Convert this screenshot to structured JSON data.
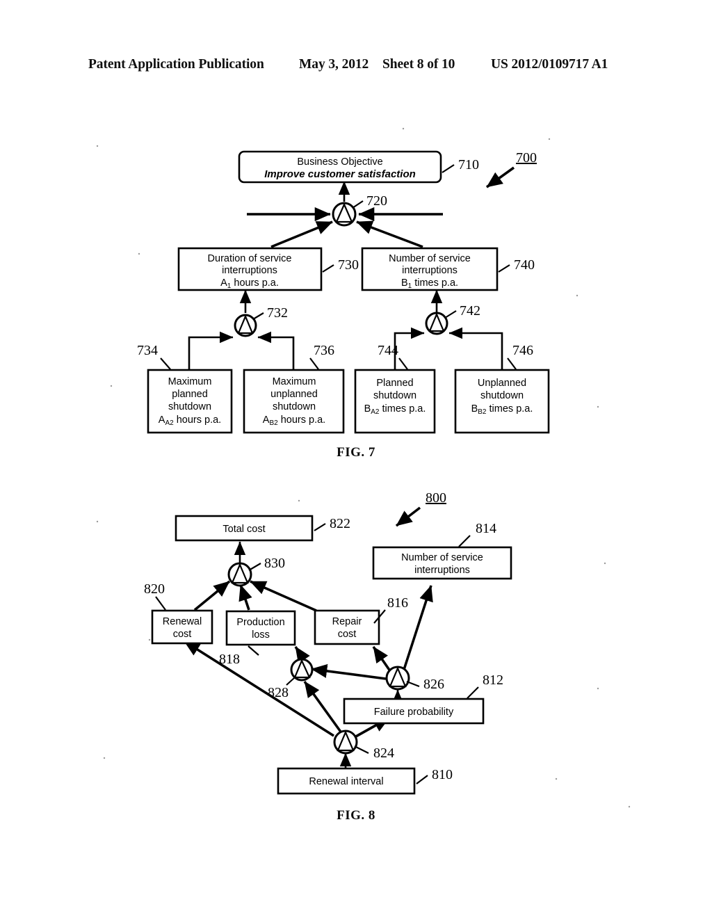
{
  "header": {
    "publication": "Patent Application Publication",
    "date": "May 3, 2012",
    "sheet": "Sheet 8 of 10",
    "patent_number": "US 2012/0109717 A1"
  },
  "figures": [
    {
      "caption": "FIG. 7",
      "figure_ref": "700",
      "nodes": [
        {
          "ref": "710",
          "lines": [
            "Business Objective",
            "Improve customer satisfaction"
          ],
          "emphasis": [
            false,
            true
          ]
        },
        {
          "ref": "720",
          "type": "aggregation-node"
        },
        {
          "ref": "730",
          "lines": [
            "Duration of service",
            "interruptions",
            "A₁ hours p.a."
          ]
        },
        {
          "ref": "740",
          "lines": [
            "Number of service",
            "interruptions",
            "B₁ times p.a."
          ]
        },
        {
          "ref": "732",
          "type": "aggregation-node"
        },
        {
          "ref": "742",
          "type": "aggregation-node"
        },
        {
          "ref": "734",
          "lines": [
            "Maximum",
            "planned",
            "shutdown",
            "Aₐ₂ hours p.a."
          ]
        },
        {
          "ref": "736",
          "lines": [
            "Maximum",
            "unplanned",
            "shutdown",
            "Aʙ₂ hours p.a."
          ]
        },
        {
          "ref": "744",
          "lines": [
            "Planned",
            "shutdown",
            "Bₐ₂ times p.a."
          ]
        },
        {
          "ref": "746",
          "lines": [
            "Unplanned",
            "shutdown",
            "Bʙ₂ times p.a."
          ]
        }
      ]
    },
    {
      "caption": "FIG. 8",
      "figure_ref": "800",
      "nodes": [
        {
          "ref": "822",
          "lines": [
            "Total cost"
          ]
        },
        {
          "ref": "830",
          "type": "aggregation-node"
        },
        {
          "ref": "814",
          "lines": [
            "Number of service",
            "interruptions"
          ]
        },
        {
          "ref": "820",
          "lines": [
            "Renewal",
            "cost"
          ]
        },
        {
          "ref": "818",
          "lines": [
            "Production",
            "loss"
          ]
        },
        {
          "ref": "816",
          "lines": [
            "Repair",
            "cost"
          ]
        },
        {
          "ref": "828",
          "type": "aggregation-node"
        },
        {
          "ref": "826",
          "type": "aggregation-node"
        },
        {
          "ref": "812",
          "lines": [
            "Failure probability"
          ]
        },
        {
          "ref": "824",
          "type": "aggregation-node"
        },
        {
          "ref": "810",
          "lines": [
            "Renewal interval"
          ]
        }
      ]
    }
  ],
  "fig7": {
    "box710_line1": "Business Objective",
    "box710_line2": "Improve customer satisfaction",
    "box730_line1": "Duration of service",
    "box730_line2": "interruptions",
    "box730_line3a": "A",
    "box730_line3sub": "1",
    "box730_line3b": " hours p.a.",
    "box740_line1": "Number of service",
    "box740_line2": "interruptions",
    "box740_line3a": "B",
    "box740_line3sub": "1",
    "box740_line3b": " times p.a.",
    "box734_line1": "Maximum",
    "box734_line2": "planned",
    "box734_line3": "shutdown",
    "box734_line4a": "A",
    "box734_line4sub": "A2",
    "box734_line4b": " hours p.a.",
    "box736_line1": "Maximum",
    "box736_line2": "unplanned",
    "box736_line3": "shutdown",
    "box736_line4a": "A",
    "box736_line4sub": "B2",
    "box736_line4b": " hours p.a.",
    "box744_line1": "Planned",
    "box744_line2": "shutdown",
    "box744_line3a": "B",
    "box744_line3sub": "A2",
    "box744_line3b": " times p.a.",
    "box746_line1": "Unplanned",
    "box746_line2": "shutdown",
    "box746_line3a": "B",
    "box746_line3sub": "B2",
    "box746_line3b": " times p.a.",
    "ref700": "700",
    "ref710": "710",
    "ref720": "720",
    "ref730": "730",
    "ref732": "732",
    "ref734": "734",
    "ref736": "736",
    "ref740": "740",
    "ref742": "742",
    "ref744": "744",
    "ref746": "746",
    "caption": "FIG. 7"
  },
  "fig8": {
    "box822_line1": "Total cost",
    "box814_line1": "Number of service",
    "box814_line2": "interruptions",
    "box820_line1": "Renewal",
    "box820_line2": "cost",
    "box818_line1": "Production",
    "box818_line2": "loss",
    "box816_line1": "Repair",
    "box816_line2": "cost",
    "box812_line1": "Failure probability",
    "box810_line1": "Renewal interval",
    "ref800": "800",
    "ref810": "810",
    "ref812": "812",
    "ref814": "814",
    "ref816": "816",
    "ref818": "818",
    "ref820": "820",
    "ref822": "822",
    "ref824": "824",
    "ref826": "826",
    "ref828": "828",
    "ref830": "830",
    "caption": "FIG. 8"
  }
}
